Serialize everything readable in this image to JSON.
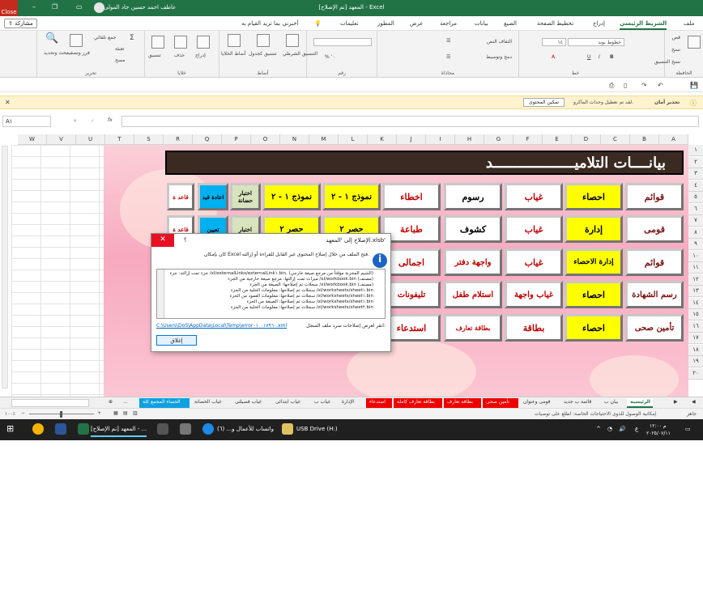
{
  "titlebar": {
    "title": "المعهد [تم الإصلاح] - Excel",
    "user": "عاطف احمد حسين جاد المولى",
    "close_tooltip": "Close"
  },
  "menu": {
    "share": "مشاركة",
    "tell_me": "أخبرني بما تريد القيام به",
    "tabs": [
      "ملف",
      "الشريط الرئيسي",
      "إدراج",
      "تخطيط الصفحة",
      "الصيغ",
      "بيانات",
      "مراجعة",
      "عرض",
      "المطور",
      "تعليمات"
    ]
  },
  "ribbon": {
    "groups": [
      "الحافظة",
      "خط",
      "محاذاة",
      "رقم",
      "أنماط",
      "خلايا",
      "تحرير"
    ],
    "paste": "لصق",
    "cut": "قص",
    "copy": "نسخ",
    "format_painter": "نسخ التنسيق",
    "font_name": "خطوط بوند",
    "font_size": "١٤",
    "wrap_text": "التفاف النص",
    "merge_center": "دمج وتوسيط",
    "cond_format": "التنسيق الشرطي",
    "format_table": "تنسيق كجدول",
    "cell_styles": "أنماط الخلايا",
    "insert": "إدراج",
    "delete": "حذف",
    "format": "تنسيق",
    "autosum": "جمع تلقائي",
    "fill": "تعبئة",
    "clear": "مسح",
    "sort_filter": "فرز وتصفية",
    "find_select": "بحث وتحديد"
  },
  "security": {
    "label": "تحذير أمان",
    "message": "لقد تم تعطيل وحدات الماكرو.",
    "button": "تمكين المحتوى"
  },
  "formula_bar": {
    "name_box": "A١",
    "fx": "fx"
  },
  "columns": [
    "A",
    "B",
    "C",
    "D",
    "E",
    "F",
    "G",
    "H",
    "I",
    "J",
    "K",
    "L",
    "M",
    "N",
    "O",
    "P",
    "Q",
    "R",
    "S",
    "T",
    "U",
    "V",
    "W"
  ],
  "rows": [
    "١",
    "٢",
    "٣",
    "٤",
    "٥",
    "٦",
    "٧",
    "٨",
    "٩",
    "١٠",
    "١١",
    "١٢",
    "١٣",
    "١٤",
    "١٥",
    "١٦",
    "١٧",
    "١٨",
    "١٩",
    "٢٠"
  ],
  "sheet": {
    "banner": "بيانــــات التلاميـــــــــــــــــــد",
    "row1": [
      "قوائم",
      "احصاء",
      "غياب",
      "رسوم",
      "اخطاء",
      "نموذج ١ - ٢",
      "نموذج ١ - ٢",
      "اختبار حضانة",
      "اعادة قيد",
      "قاعد ة"
    ],
    "row2": [
      "قومى",
      "إدارة",
      "غياب",
      "كشوف",
      "طباعة",
      "حصر ٢",
      "حصر ٢",
      "اختبار",
      "تعيين",
      "قاعد ة"
    ],
    "row3": [
      "قوائم",
      "إدارة الاحصاء",
      "غياب",
      "واجهة دفتر",
      "اجمالى"
    ],
    "row4": [
      "رسم الشهادة",
      "احصاء",
      "غياب واجهة",
      "استلام طفل",
      "تليفونات"
    ],
    "row5": [
      "تأمين صحى",
      "احصاء",
      "بطاقة",
      "بطاقة تعارف",
      "استدعاء"
    ]
  },
  "dialog": {
    "title": "الإصلاح إلى 'المعهد.xlsb'",
    "question": "؟",
    "message": "كان بإمكان Excel فتح الملف من خلال إصلاح المحتوى غير القابل للقراءة أو إزالته.",
    "log": [
      "جزء تمت إزالته: جزء /xl/externalLinks/externalLink١.bin. (الشيم المخزنة مؤقتاً من مرجع صيغة خارجي)",
      "ميزات تمت إزالتها: مرجع صيغة خارجية من الجزء /xl/workbook.bin (مصنف)",
      "سجلات تم إصلاحها: الصيغة من الجزء /xl/workbook.bin (مصنف)",
      "سجلات تم إصلاحها: معلومات الخلية من الجزء /xl/worksheets/sheet١.bin",
      "سجلات تم إصلاحها: معلومات العمود من الجزء /xl/worksheets/sheet١.bin",
      "سجلات تم إصلاحها: الصيغة من الجزء /xl/worksheets/sheet١.bin",
      "سجلات تم إصلاحها: معلومات الخلية من الجزء /xl/worksheets/sheet٢.bin"
    ],
    "log_link_label": "انقر لعرض إصلاحات سرد ملف السجل:",
    "log_link": "C:\\Users\\DoS\\AppData\\Local\\Temp\\error٠١٧٩٦٠_٠١.xml",
    "close_button": "إغلاق"
  },
  "sheet_tabs": [
    "الرئيسية",
    "بيان ب",
    "قائمة ب جديد",
    "قومى وعنوان",
    "تأمين صحى",
    "بطاقة تعارف",
    "بطاقة تعارف كاملة",
    "استدعاء",
    "الإدارة",
    "غياب ب",
    "غياب ابتدائى",
    "غياب فصيلتى",
    "غياب الحضانة",
    "الحصاء المجمع كلة",
    "..."
  ],
  "status": {
    "ready": "جاهز",
    "accessibility": "إمكانية الوصول للذوى الاحتياجات الخاصة: اطلع على توصيات",
    "zoom": "١٠٠٪"
  },
  "taskbar": {
    "apps": [
      "المعهد [تم الإصلاح] - ...",
      "واتساب للأعمال و... (٦)",
      "USB Drive (H:)"
    ],
    "time": "م ١٢:٠٠",
    "date": "٢٠٢٥/٠٧/١١",
    "lang": "ع"
  }
}
